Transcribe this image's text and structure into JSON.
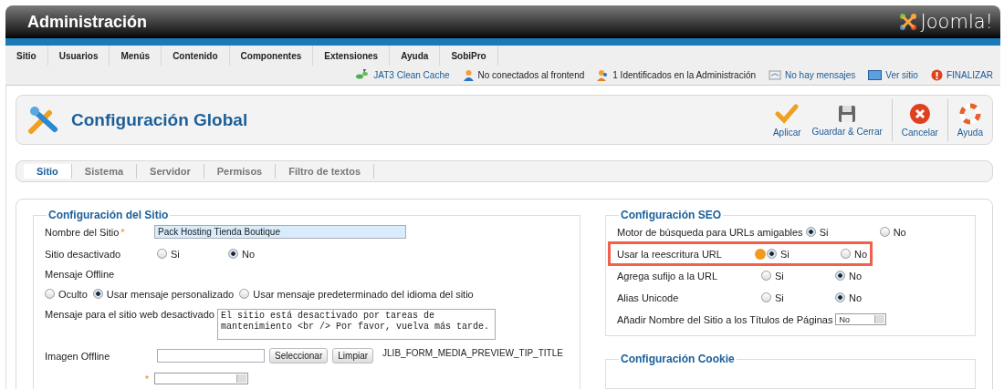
{
  "header": {
    "title": "Administración",
    "logo_text": "Joomla!"
  },
  "menu": [
    "Sitio",
    "Usuarios",
    "Menús",
    "Contenido",
    "Componentes",
    "Extensiones",
    "Ayuda",
    "SobiPro"
  ],
  "status": [
    {
      "kind": "cache",
      "label": "JAT3 Clean Cache",
      "link": true
    },
    {
      "kind": "users",
      "label": "No conectados al frontend",
      "link": false
    },
    {
      "kind": "admin",
      "label": "1 Identificados en la Administración",
      "link": false
    },
    {
      "kind": "messages",
      "label": "No hay mensajes",
      "link": true
    },
    {
      "kind": "site",
      "label": "Ver sitio",
      "link": true
    },
    {
      "kind": "logout",
      "label": "FINALIZAR",
      "link": true
    }
  ],
  "toolbar": {
    "title": "Configuración Global",
    "buttons": [
      {
        "kind": "apply",
        "label": "Aplicar",
        "separated": false
      },
      {
        "kind": "save",
        "label": "Guardar & Cerrar",
        "separated": false
      },
      {
        "kind": "cancel",
        "label": "Cancelar",
        "separated": true
      },
      {
        "kind": "help",
        "label": "Ayuda",
        "separated": true
      }
    ]
  },
  "tabs": [
    {
      "label": "Sitio",
      "selected": true
    },
    {
      "label": "Sistema",
      "selected": false
    },
    {
      "label": "Servidor",
      "selected": false
    },
    {
      "label": "Permisos",
      "selected": false
    },
    {
      "label": "Filtro de textos",
      "selected": false
    }
  ],
  "site_config": {
    "legend": "Configuración del Sitio",
    "fields": [
      {
        "kind": "text",
        "label": "Nombre del Sitio",
        "mark": "*",
        "value": "Pack Hosting Tienda Boutique"
      },
      {
        "kind": "radio",
        "label": "Sitio desactivado",
        "options": [
          {
            "label": "Si",
            "selected": false
          },
          {
            "label": "No",
            "selected": true
          }
        ]
      },
      {
        "kind": "radio_stacked",
        "label": "Mensaje Offline",
        "options": [
          {
            "label": "Oculto",
            "selected": false
          },
          {
            "label": "Usar mensaje personalizado",
            "selected": true
          },
          {
            "label": "Usar mensaje predeterminado del idioma del sitio",
            "selected": false
          }
        ]
      },
      {
        "kind": "textarea",
        "label": "Mensaje para el sitio web desactivado",
        "value": "El sitio está desactivado por tareas de mantenimiento <br /> Por favor, vuelva más tarde."
      },
      {
        "kind": "media",
        "label": "Imagen Offline",
        "buttons": [
          "Seleccionar",
          "Limpiar"
        ],
        "preview": "JLIB_FORM_MEDIA_PREVIEW_TIP_TITLE"
      },
      {
        "kind": "select",
        "mark": "*"
      }
    ]
  },
  "seo_config": {
    "legend": "Configuración SEO",
    "fields": [
      {
        "kind": "radio",
        "label": "Motor de búsqueda para URLs amigables",
        "highlighted": false,
        "warning": false,
        "options": [
          {
            "label": "Si",
            "selected": true
          },
          {
            "label": "No",
            "selected": false
          }
        ]
      },
      {
        "kind": "radio",
        "label": "Usar la reescritura URL",
        "highlighted": true,
        "warning": true,
        "options": [
          {
            "label": "Si",
            "selected": true
          },
          {
            "label": "No",
            "selected": false
          }
        ]
      },
      {
        "kind": "radio",
        "label": "Agrega sufijo a la URL",
        "highlighted": false,
        "warning": false,
        "options": [
          {
            "label": "Si",
            "selected": false
          },
          {
            "label": "No",
            "selected": true
          }
        ]
      },
      {
        "kind": "radio",
        "label": "Alias Unicode",
        "highlighted": false,
        "warning": false,
        "options": [
          {
            "label": "Si",
            "selected": false
          },
          {
            "label": "No",
            "selected": true
          }
        ]
      },
      {
        "kind": "select",
        "label": "Añadir Nombre del Sitio a los Títulos de Páginas",
        "value": "No"
      }
    ]
  },
  "cookie_config": {
    "legend": "Configuración Cookie"
  }
}
